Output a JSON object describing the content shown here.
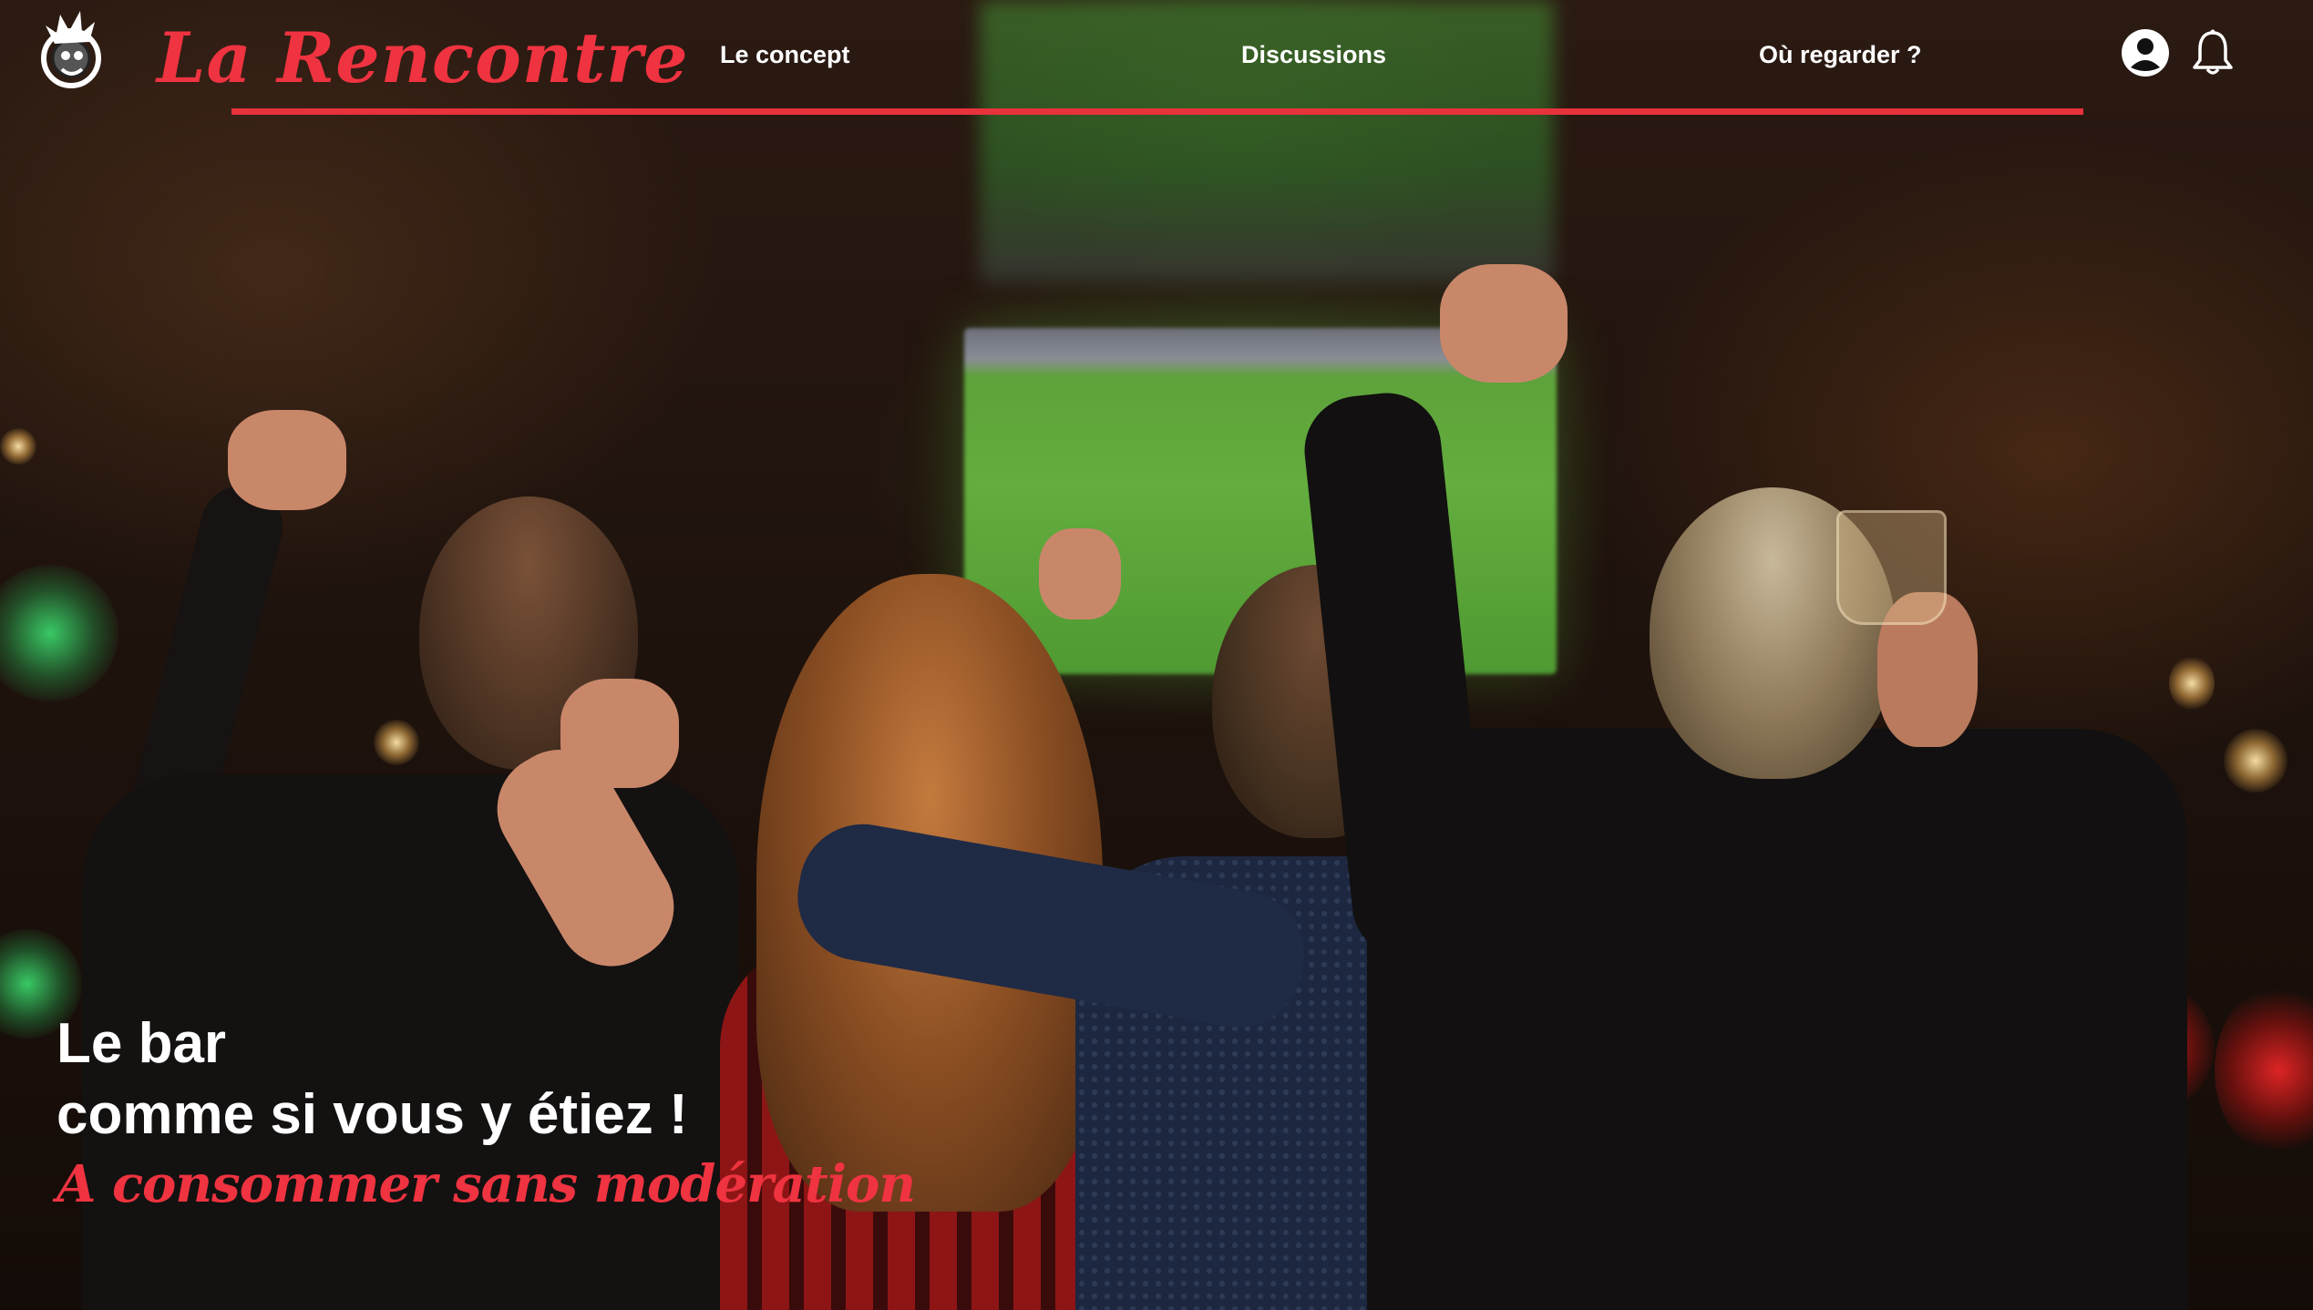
{
  "header": {
    "brand": "La Rencontre",
    "nav": [
      {
        "label": "Le concept"
      },
      {
        "label": "Discussions"
      },
      {
        "label": "Où regarder ?"
      }
    ],
    "icons": {
      "logo": "mascot-logo-icon",
      "account": "user-account-icon",
      "notifications": "bell-icon"
    }
  },
  "hero": {
    "line1": "Le bar",
    "line2": "comme si vous y étiez !",
    "tagline": "A consommer sans modération"
  },
  "colors": {
    "accent": "#ef3340",
    "nav_line": "#e8323c",
    "text": "#ffffff"
  }
}
